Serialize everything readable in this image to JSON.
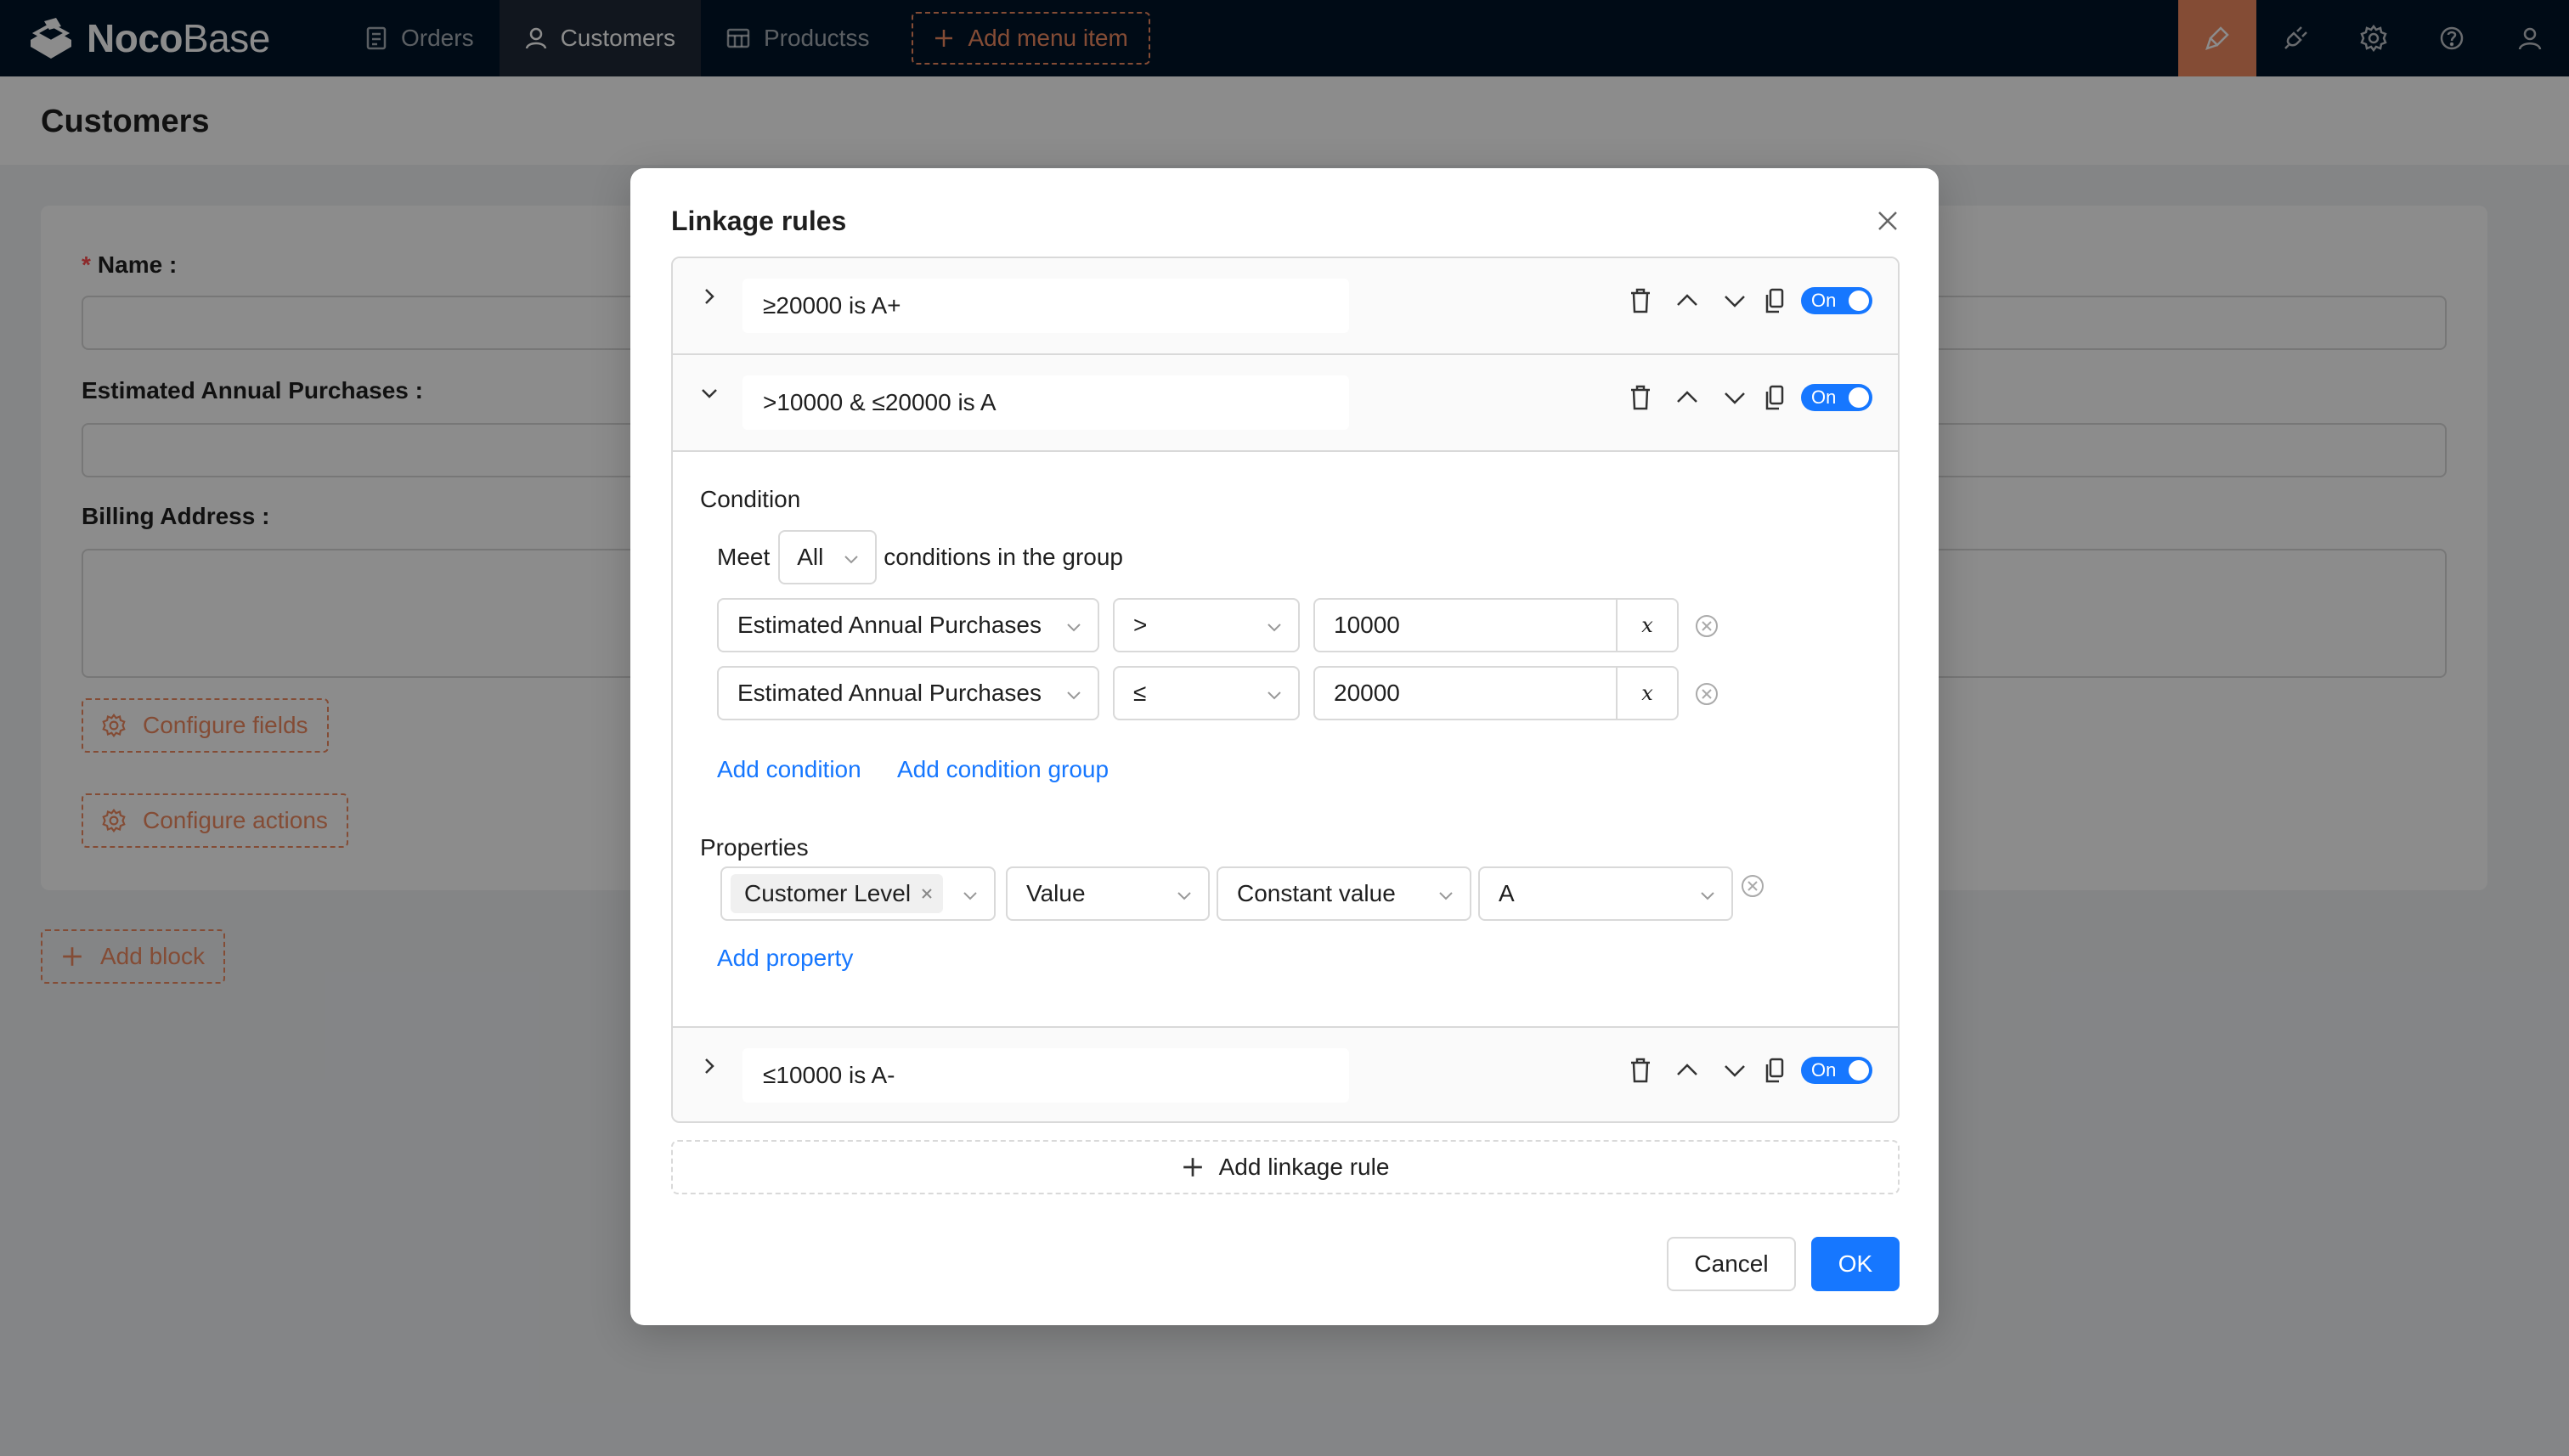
{
  "app": {
    "logo_bold": "Noco",
    "logo_thin": "Base",
    "nav": [
      {
        "label": "Orders",
        "icon": "file-icon"
      },
      {
        "label": "Customers",
        "icon": "user-icon"
      },
      {
        "label": "Productss",
        "icon": "table-icon"
      }
    ],
    "add_menu_label": "Add menu item",
    "colors": {
      "topbar": "#001529",
      "accent": "#f18b62",
      "primary": "#1677ff"
    }
  },
  "page": {
    "title": "Customers",
    "fields": [
      {
        "label": "Name",
        "required": true
      },
      {
        "label": "Estimated Annual Purchases",
        "required": false
      },
      {
        "label": "Billing Address",
        "required": false
      }
    ],
    "configure_fields": "Configure fields",
    "configure_actions": "Configure actions",
    "add_block": "Add block"
  },
  "modal": {
    "title": "Linkage rules",
    "rules": [
      {
        "title": "≥20000 is A+",
        "expanded": false,
        "enabled_label": "On"
      },
      {
        "title": ">10000 & ≤20000 is A",
        "expanded": true,
        "enabled_label": "On"
      },
      {
        "title": "≤10000 is A-",
        "expanded": false,
        "enabled_label": "On"
      }
    ],
    "condition": {
      "label": "Condition",
      "meet_prefix": "Meet",
      "meet_value": "All",
      "meet_suffix": "conditions in the group",
      "rows": [
        {
          "field": "Estimated Annual Purchases",
          "operator": ">",
          "value": "10000",
          "var_label": "x"
        },
        {
          "field": "Estimated Annual Purchases",
          "operator": "≤",
          "value": "20000",
          "var_label": "x"
        }
      ],
      "add_condition": "Add condition",
      "add_condition_group": "Add condition group"
    },
    "properties": {
      "label": "Properties",
      "rows": [
        {
          "field_tag": "Customer Level",
          "action": "Value",
          "mode": "Constant value",
          "value": "A"
        }
      ],
      "add_property": "Add property"
    },
    "add_rule": "Add linkage rule",
    "cancel": "Cancel",
    "ok": "OK"
  }
}
